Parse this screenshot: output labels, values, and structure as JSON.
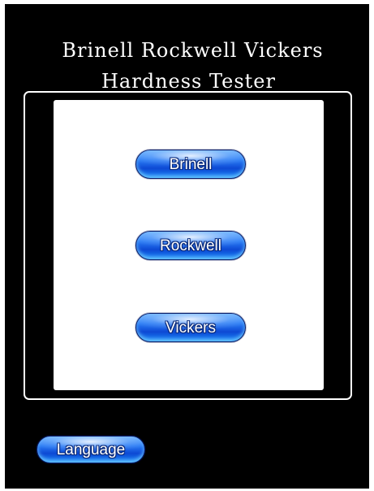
{
  "header": {
    "title_line1": "Brinell Rockwell Vickers",
    "title_line2": "Hardness Tester"
  },
  "menu": {
    "buttons": [
      {
        "label": "Brinell"
      },
      {
        "label": "Rockwell"
      },
      {
        "label": "Vickers"
      }
    ]
  },
  "footer": {
    "language_label": "Language"
  },
  "colors": {
    "background": "#000000",
    "panel": "#ffffff",
    "button_blue": "#2a7cf5",
    "button_outline": "#0a1f6b"
  }
}
